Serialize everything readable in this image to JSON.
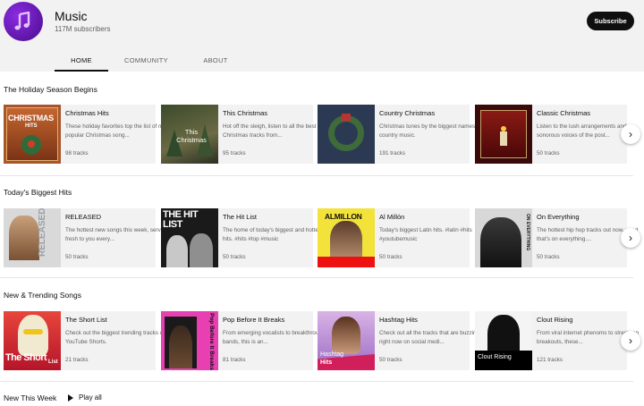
{
  "channel": {
    "name": "Music",
    "subscribers": "117M subscribers",
    "subscribe_label": "Subscribe"
  },
  "tabs": [
    {
      "label": "HOME",
      "active": true
    },
    {
      "label": "COMMUNITY",
      "active": false
    },
    {
      "label": "ABOUT",
      "active": false
    }
  ],
  "sections": [
    {
      "title": "The Holiday Season Begins",
      "cards": [
        {
          "title": "Christmas Hits",
          "desc": "These holiday favorites top the list of most popular Christmas song...",
          "tracks": "98 tracks",
          "thumb_text": "CHRISTMAS",
          "thumb_sub": "HITS"
        },
        {
          "title": "This Christmas",
          "desc": "Hot off the sleigh, listen to all the best new Christmas tracks from...",
          "tracks": "95 tracks",
          "thumb_text": "This Christmas"
        },
        {
          "title": "Country Christmas",
          "desc": "Christmas tunes by the biggest names in country music.",
          "tracks": "191 tracks"
        },
        {
          "title": "Classic Christmas",
          "desc": "Listen to the lush arrangements and sonorous voices of the post...",
          "tracks": "50 tracks"
        }
      ]
    },
    {
      "title": "Today's Biggest Hits",
      "cards": [
        {
          "title": "RELEASED",
          "desc": "The hottest new songs this week, served up fresh to you every...",
          "tracks": "50 tracks",
          "thumb_text": "RELEASED"
        },
        {
          "title": "The Hit List",
          "desc": "The home of today's biggest and hottest hits. #hits #top #music",
          "tracks": "50 tracks",
          "thumb_text": "THE HIT LIST"
        },
        {
          "title": "Al Millón",
          "desc": "Today's biggest Latin hits. #latin #hits #youtubemusic",
          "tracks": "50 tracks",
          "thumb_text": "ALMILLON"
        },
        {
          "title": "On Everything",
          "desc": "The hottest hip hop tracks out now... and that's on everything....",
          "tracks": "50 tracks",
          "thumb_text": "ON EVERYTHING"
        }
      ]
    },
    {
      "title": "New & Trending Songs",
      "cards": [
        {
          "title": "The Short List",
          "desc": "Check out the biggest trending tracks on YouTube Shorts.",
          "tracks": "21 tracks",
          "thumb_text": "The Short",
          "thumb_sub": "List"
        },
        {
          "title": "Pop Before It Breaks",
          "desc": "From emerging vocalists to breakthrough bands, this is an...",
          "tracks": "81 tracks",
          "thumb_text": "Pop Before It Breaks"
        },
        {
          "title": "Hashtag Hits",
          "desc": "Check out all the tracks that are buzzing right now on social medi...",
          "tracks": "50 tracks",
          "thumb_text": "Hashtag",
          "thumb_sub": "Hits"
        },
        {
          "title": "Clout Rising",
          "desc": "From viral internet phenoms to street-rap breakouts, these...",
          "tracks": "121 tracks",
          "thumb_text": "Clout Rising"
        }
      ]
    },
    {
      "title": "New This Week",
      "play_all_label": "Play all"
    }
  ]
}
